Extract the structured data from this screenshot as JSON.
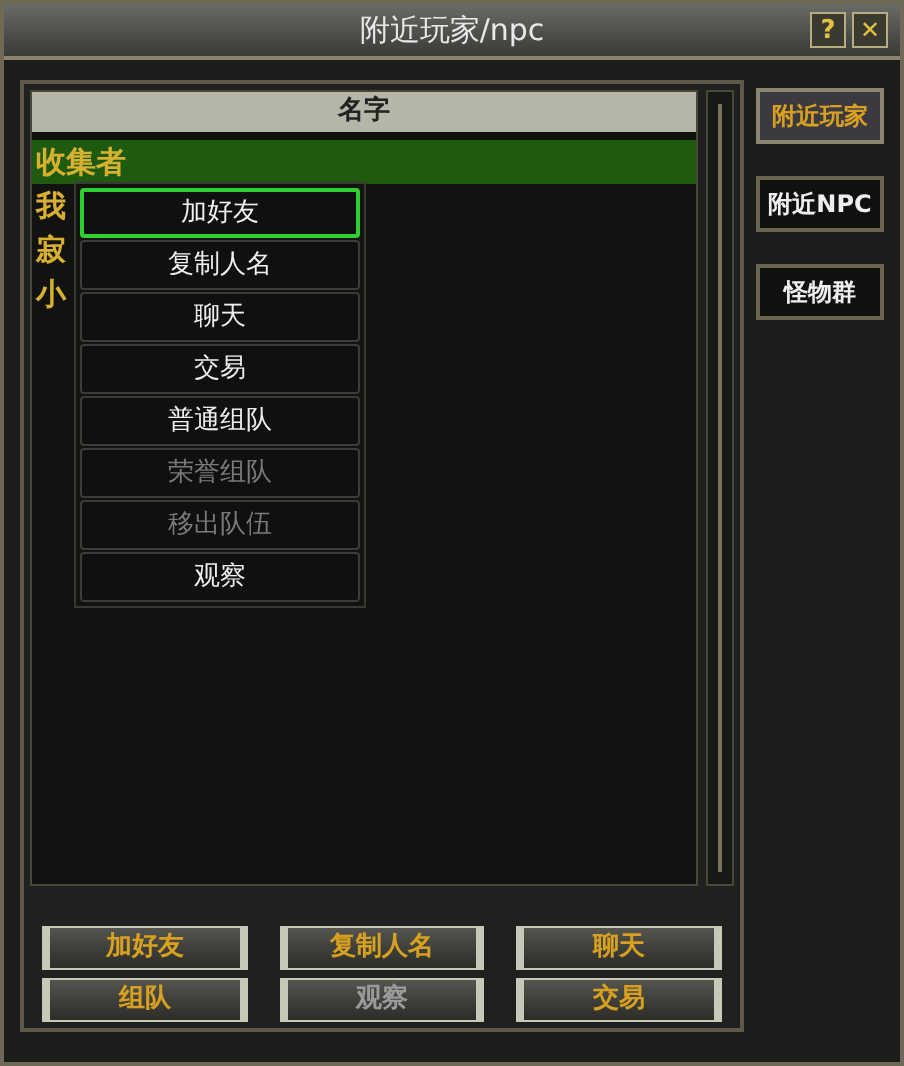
{
  "window": {
    "title": "附近玩家/npc",
    "help": "?",
    "close": "✕"
  },
  "list": {
    "column": "名字",
    "rows": [
      {
        "name": "收集者",
        "selected": true
      },
      {
        "name": "我",
        "selected": false
      },
      {
        "name": "寂",
        "selected": false
      },
      {
        "name": "小",
        "selected": false
      }
    ]
  },
  "tabs": [
    {
      "label": "附近玩家",
      "selected": true
    },
    {
      "label": "附近NPC",
      "selected": false
    },
    {
      "label": "怪物群",
      "selected": false
    }
  ],
  "context_menu": [
    {
      "label": "加好友",
      "disabled": false,
      "highlighted": true
    },
    {
      "label": "复制人名",
      "disabled": false,
      "highlighted": false
    },
    {
      "label": "聊天",
      "disabled": false,
      "highlighted": false
    },
    {
      "label": "交易",
      "disabled": false,
      "highlighted": false
    },
    {
      "label": "普通组队",
      "disabled": false,
      "highlighted": false
    },
    {
      "label": "荣誉组队",
      "disabled": true,
      "highlighted": false
    },
    {
      "label": "移出队伍",
      "disabled": true,
      "highlighted": false
    },
    {
      "label": "观察",
      "disabled": false,
      "highlighted": false
    }
  ],
  "buttons": [
    {
      "label": "加好友",
      "disabled": false
    },
    {
      "label": "复制人名",
      "disabled": false
    },
    {
      "label": "聊天",
      "disabled": false
    },
    {
      "label": "组队",
      "disabled": false
    },
    {
      "label": "观察",
      "disabled": true
    },
    {
      "label": "交易",
      "disabled": false
    }
  ]
}
